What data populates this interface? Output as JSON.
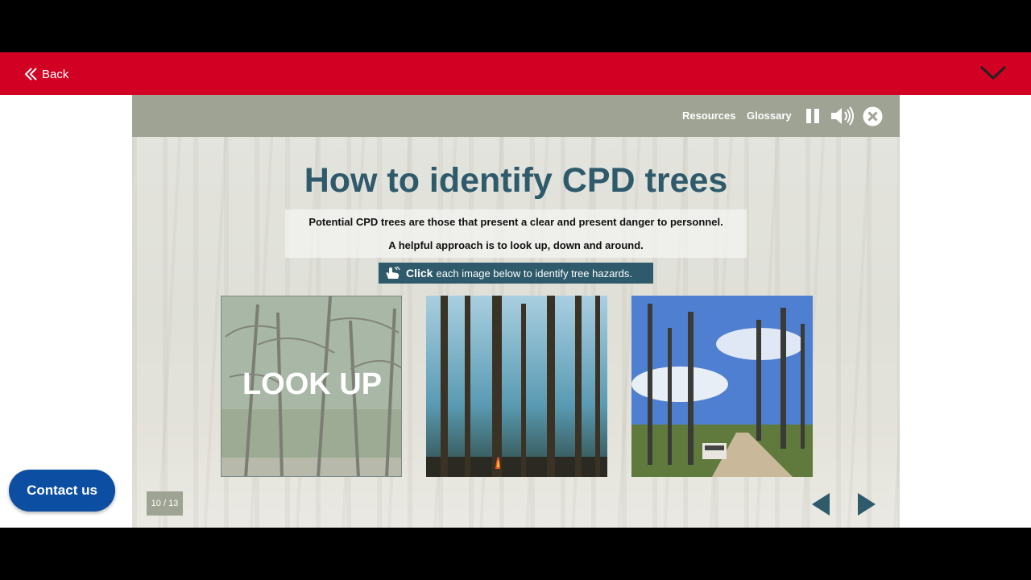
{
  "header": {
    "back_label": "Back",
    "brand_color": "#d20022"
  },
  "toolbar": {
    "resources_label": "Resources",
    "glossary_label": "Glossary",
    "icons": [
      "pause-icon",
      "volume-icon",
      "close-icon"
    ]
  },
  "slide": {
    "title": "How to identify CPD trees",
    "line1": "Potential CPD trees are those that present a clear and present danger to personnel.",
    "line2": "A helpful approach is to look up, down and around.",
    "instruction_bold": "Click",
    "instruction_rest": "each image below to identify tree hazards.",
    "cards": [
      {
        "label": "LOOK UP"
      },
      {
        "label": ""
      },
      {
        "label": ""
      }
    ],
    "page_counter": "10 / 13",
    "accent_color": "#2e5a6b"
  },
  "contact": {
    "label": "Contact us",
    "color": "#0b4ea2"
  }
}
